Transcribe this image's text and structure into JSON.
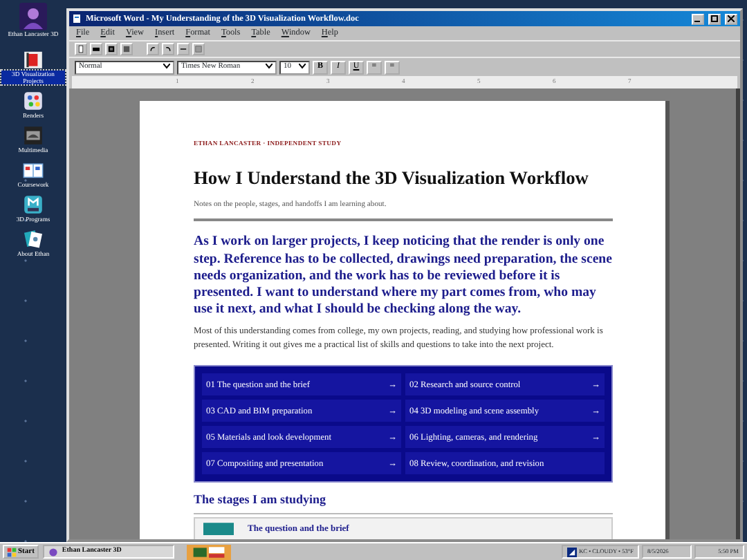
{
  "desktop_icons": [
    {
      "label": "Ethan Lancaster 3D",
      "selected": false
    },
    {
      "label": "3D Visualization Projects",
      "selected": true
    },
    {
      "label": "Renders",
      "selected": false
    },
    {
      "label": "Multimedia",
      "selected": false
    },
    {
      "label": "Coursework",
      "selected": false
    },
    {
      "label": "3D Programs",
      "selected": false
    },
    {
      "label": "About Ethan",
      "selected": false
    }
  ],
  "window": {
    "title": "Microsoft Word - My Understanding of the 3D Visualization Workflow.doc"
  },
  "menu": [
    "File",
    "Edit",
    "View",
    "Insert",
    "Format",
    "Tools",
    "Table",
    "Window",
    "Help"
  ],
  "format_bar": {
    "style": "Normal",
    "font": "Times New Roman",
    "size": "10",
    "buttons": [
      "B",
      "I",
      "U",
      "≡",
      "≡"
    ]
  },
  "ruler": [
    "1",
    "2",
    "3",
    "4",
    "5",
    "6",
    "7"
  ],
  "document": {
    "kicker": "ETHAN LANCASTER · INDEPENDENT STUDY",
    "title": "How I Understand the 3D Visualization Workflow",
    "subtitle": "Notes on the people, stages, and handoffs I am learning about.",
    "lede": "As I work on larger projects, I keep noticing that the render is only one step. Reference has to be collected, drawings need preparation, the scene needs organization, and the work has to be reviewed before it is presented. I want to understand where my part comes from, who may use it next, and what I should be checking along the way.",
    "body": "Most of this understanding comes from college, my own projects, reading, and studying how professional work is presented. Writing it out gives me a practical list of skills and questions to take into the next project.",
    "stages": [
      {
        "label": "01 The question and the brief",
        "arrow": "→"
      },
      {
        "label": "02 Research and source control",
        "arrow": "→"
      },
      {
        "label": "03 CAD and BIM preparation",
        "arrow": "→"
      },
      {
        "label": "04 3D modeling and scene assembly",
        "arrow": "→"
      },
      {
        "label": "05 Materials and look development",
        "arrow": "→"
      },
      {
        "label": "06 Lighting, cameras, and rendering",
        "arrow": "→"
      },
      {
        "label": "07 Compositing and presentation",
        "arrow": "→"
      },
      {
        "label": "08 Review, coordination, and revision"
      }
    ],
    "section_heading": "The stages I am studying",
    "card_title": "The question and the brief"
  },
  "taskbar": {
    "start": "Start",
    "task": "Ethan Lancaster 3D",
    "weather": "KC • CLOUDY • 53°F",
    "date": "8/5/2026",
    "time": "5:50 PM"
  }
}
